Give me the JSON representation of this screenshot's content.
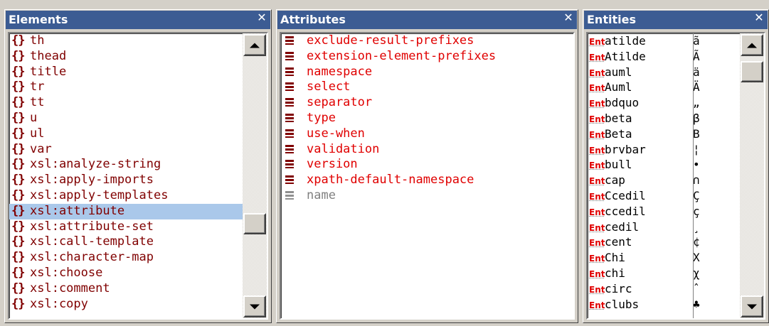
{
  "elements_panel": {
    "title": "Elements",
    "close_label": "✕",
    "items": [
      {
        "label": "th"
      },
      {
        "label": "thead"
      },
      {
        "label": "title"
      },
      {
        "label": "tr"
      },
      {
        "label": "tt"
      },
      {
        "label": "u"
      },
      {
        "label": "ul"
      },
      {
        "label": "var"
      },
      {
        "label": "xsl:analyze-string"
      },
      {
        "label": "xsl:apply-imports"
      },
      {
        "label": "xsl:apply-templates"
      },
      {
        "label": "xsl:attribute",
        "selected": true
      },
      {
        "label": "xsl:attribute-set"
      },
      {
        "label": "xsl:call-template"
      },
      {
        "label": "xsl:character-map"
      },
      {
        "label": "xsl:choose"
      },
      {
        "label": "xsl:comment"
      },
      {
        "label": "xsl:copy"
      }
    ],
    "icon": "xml-element-brace-icon",
    "scroll_position": 0.72
  },
  "attributes_panel": {
    "title": "Attributes",
    "close_label": "✕",
    "items": [
      {
        "label": "exclude-result-prefixes",
        "style": "required"
      },
      {
        "label": "extension-element-prefixes",
        "style": "required"
      },
      {
        "label": "namespace",
        "style": "required"
      },
      {
        "label": "select",
        "style": "required"
      },
      {
        "label": "separator",
        "style": "required"
      },
      {
        "label": "type",
        "style": "required"
      },
      {
        "label": "use-when",
        "style": "required"
      },
      {
        "label": "validation",
        "style": "required"
      },
      {
        "label": "version",
        "style": "required"
      },
      {
        "label": "xpath-default-namespace",
        "style": "required"
      },
      {
        "label": "name",
        "style": "used"
      }
    ],
    "icon": "attribute-equals-icon"
  },
  "entities_panel": {
    "title": "Entities",
    "close_label": "✕",
    "tag": "Ent",
    "items": [
      {
        "name": "atilde",
        "char": "ã"
      },
      {
        "name": "Atilde",
        "char": "Ã"
      },
      {
        "name": "auml",
        "char": "ä"
      },
      {
        "name": "Auml",
        "char": "Ä"
      },
      {
        "name": "bdquo",
        "char": "„"
      },
      {
        "name": "beta",
        "char": "β"
      },
      {
        "name": "Beta",
        "char": "Β"
      },
      {
        "name": "brvbar",
        "char": "¦"
      },
      {
        "name": "bull",
        "char": "•"
      },
      {
        "name": "cap",
        "char": "∩"
      },
      {
        "name": "Ccedil",
        "char": "Ç"
      },
      {
        "name": "ccedil",
        "char": "ç"
      },
      {
        "name": "cedil",
        "char": "¸"
      },
      {
        "name": "cent",
        "char": "¢"
      },
      {
        "name": "Chi",
        "char": "Χ"
      },
      {
        "name": "chi",
        "char": "χ"
      },
      {
        "name": "circ",
        "char": "ˆ"
      },
      {
        "name": "clubs",
        "char": "♣"
      }
    ],
    "scroll_position": 0.02
  },
  "colors": {
    "titlebar": "#3c5c93",
    "element_text": "#800000",
    "attribute_text": "#e00000",
    "selection": "#aac8ea"
  }
}
